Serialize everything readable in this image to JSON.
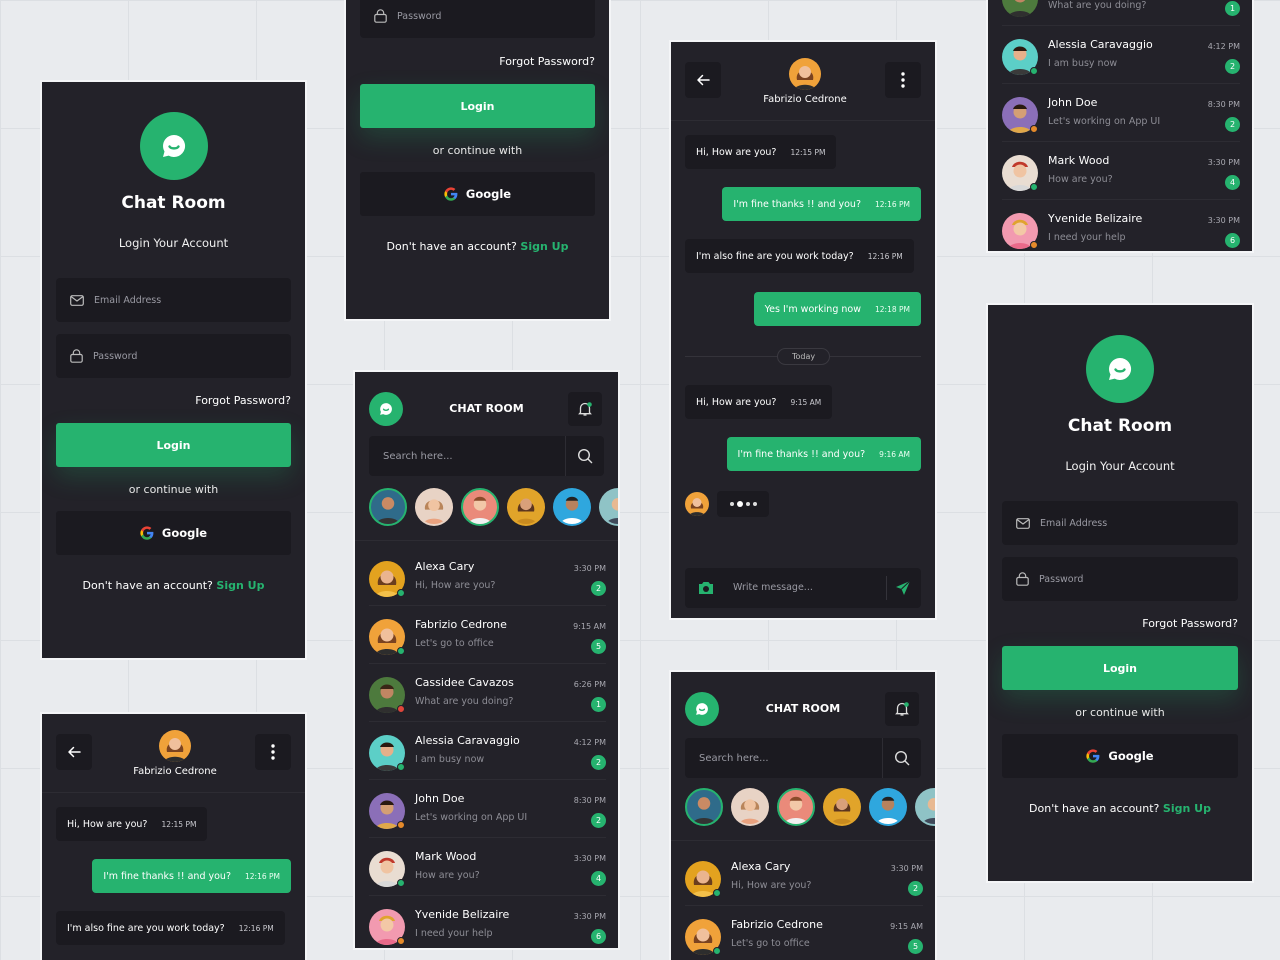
{
  "login": {
    "title": "Chat Room",
    "subtitle": "Login Your Account",
    "email_placeholder": "Email Address",
    "password_placeholder": "Password",
    "forgot": "Forgot Password?",
    "login_button": "Login",
    "or_continue": "or continue with",
    "google": "Google",
    "no_account": "Don't have an account?",
    "sign_up": "Sign Up"
  },
  "list": {
    "title": "CHAT ROOM",
    "search_placeholder": "Search here...",
    "chats": [
      {
        "name": "Alexa Cary",
        "preview": "Hi, How are you?",
        "time": "3:30 PM",
        "unread": "2"
      },
      {
        "name": "Fabrizio Cedrone",
        "preview": "Let's go to office",
        "time": "9:15 AM",
        "unread": "5"
      },
      {
        "name": "Cassidee Cavazos",
        "preview": "What are you doing?",
        "time": "6:26 PM",
        "unread": "1"
      },
      {
        "name": "Alessia Caravaggio",
        "preview": "I am busy now",
        "time": "4:12 PM",
        "unread": "2"
      },
      {
        "name": "John Doe",
        "preview": "Let's working on App UI",
        "time": "8:30 PM",
        "unread": "2"
      },
      {
        "name": "Mark Wood",
        "preview": "How are you?",
        "time": "3:30 PM",
        "unread": "4"
      },
      {
        "name": "Yvenide Belizaire",
        "preview": "I need your help",
        "time": "3:30 PM",
        "unread": "6"
      }
    ],
    "partial_top_preview": "What are you doing?",
    "partial_top_unread": "1"
  },
  "chat": {
    "contact": "Fabrizio Cedrone",
    "messages": [
      {
        "text": "Hi, How are you?",
        "time": "12:15 PM",
        "dir": "in"
      },
      {
        "text": "I'm fine thanks !! and you?",
        "time": "12:16 PM",
        "dir": "out"
      },
      {
        "text": "I'm also fine are you work today?",
        "time": "12:16 PM",
        "dir": "in"
      },
      {
        "text": "Yes I'm working now",
        "time": "12:18 PM",
        "dir": "out"
      },
      {
        "text": "Hi, How are you?",
        "time": "9:15 AM",
        "dir": "in"
      },
      {
        "text": "I'm fine thanks !! and you?",
        "time": "9:16 AM",
        "dir": "out"
      }
    ],
    "today": "Today",
    "composer_placeholder": "Write message..."
  },
  "colors": {
    "background": "#e9ebee",
    "panel": "#232229",
    "field": "#1b1a20",
    "accent": "#26b36f"
  },
  "icons": [
    "chat-bubble-icon",
    "mail-icon",
    "lock-icon",
    "google-icon",
    "bell-icon",
    "search-icon",
    "back-arrow-icon",
    "more-vertical-icon",
    "camera-icon",
    "send-icon"
  ]
}
